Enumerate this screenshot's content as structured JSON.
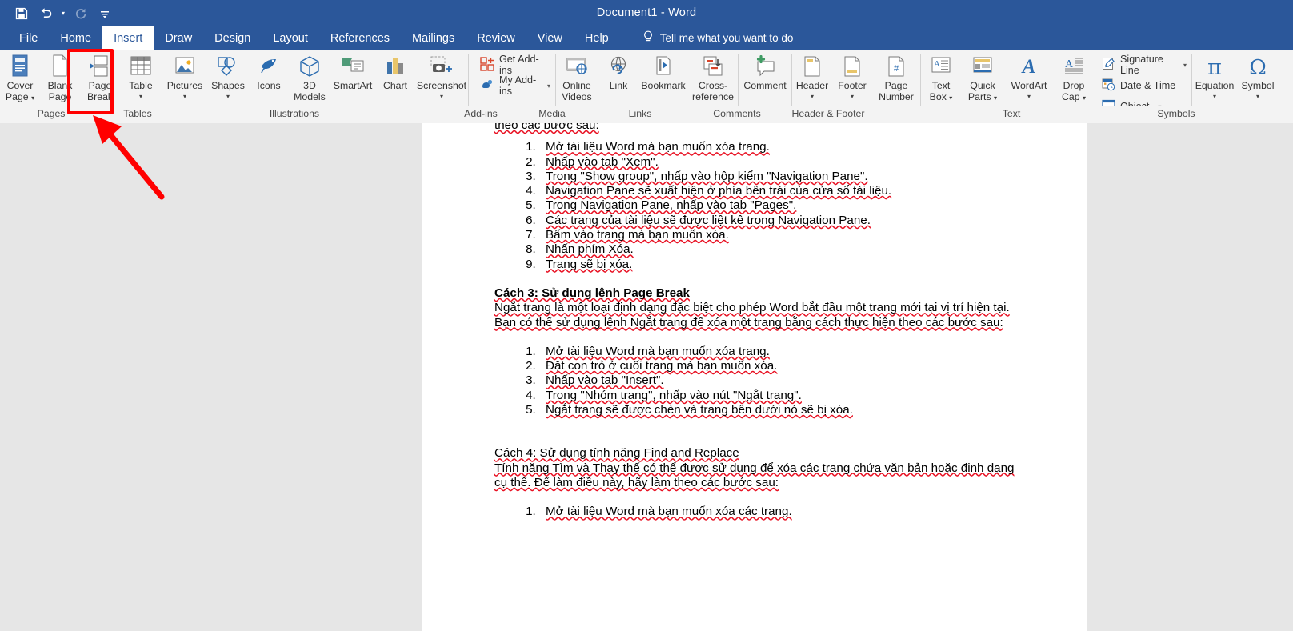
{
  "titlebar": {
    "document_title": "Document1  -  Word",
    "qat": [
      {
        "name": "save",
        "label": "Save"
      },
      {
        "name": "undo",
        "label": "Undo"
      },
      {
        "name": "redo",
        "label": "Redo"
      },
      {
        "name": "customize",
        "label": "Customize Quick Access Toolbar"
      }
    ]
  },
  "tabs": [
    {
      "label": "File",
      "active": false
    },
    {
      "label": "Home",
      "active": false
    },
    {
      "label": "Insert",
      "active": true
    },
    {
      "label": "Draw",
      "active": false
    },
    {
      "label": "Design",
      "active": false
    },
    {
      "label": "Layout",
      "active": false
    },
    {
      "label": "References",
      "active": false
    },
    {
      "label": "Mailings",
      "active": false
    },
    {
      "label": "Review",
      "active": false
    },
    {
      "label": "View",
      "active": false
    },
    {
      "label": "Help",
      "active": false
    }
  ],
  "tellme": {
    "label": "Tell me what you want to do",
    "icon": "lightbulb-icon"
  },
  "ribbon": {
    "groups": [
      {
        "label": "Pages",
        "buttons": [
          {
            "label": "Cover\nPage",
            "line1": "Cover",
            "line2": "Page",
            "caret": true
          },
          {
            "label": "Blank\nPage",
            "line1": "Blank",
            "line2": "Page",
            "caret": false
          },
          {
            "label": "Page\nBreak",
            "line1": "Page",
            "line2": "Break",
            "caret": false,
            "highlighted": true
          }
        ]
      },
      {
        "label": "Tables",
        "buttons": [
          {
            "line1": "Table",
            "line2": "",
            "caret": true
          }
        ]
      },
      {
        "label": "Illustrations",
        "buttons": [
          {
            "line1": "Pictures",
            "line2": "",
            "caret": true
          },
          {
            "line1": "Shapes",
            "line2": "",
            "caret": true
          },
          {
            "line1": "Icons",
            "line2": "",
            "caret": false
          },
          {
            "line1": "3D",
            "line2": "Models",
            "caret": true
          },
          {
            "line1": "SmartArt",
            "line2": "",
            "caret": false
          },
          {
            "line1": "Chart",
            "line2": "",
            "caret": false
          },
          {
            "line1": "Screenshot",
            "line2": "",
            "caret": true
          }
        ]
      },
      {
        "label": "Add-ins",
        "small_buttons": [
          {
            "label": "Get Add-ins",
            "caret": false
          },
          {
            "label": "My Add-ins",
            "caret": true
          }
        ]
      },
      {
        "label": "Media",
        "buttons": [
          {
            "line1": "Online",
            "line2": "Videos",
            "caret": false
          }
        ]
      },
      {
        "label": "Links",
        "buttons": [
          {
            "line1": "Link",
            "line2": "",
            "caret": false
          },
          {
            "line1": "Bookmark",
            "line2": "",
            "caret": false
          },
          {
            "line1": "Cross-",
            "line2": "reference",
            "caret": false
          }
        ]
      },
      {
        "label": "Comments",
        "buttons": [
          {
            "line1": "Comment",
            "line2": "",
            "caret": false
          }
        ]
      },
      {
        "label": "Header & Footer",
        "buttons": [
          {
            "line1": "Header",
            "line2": "",
            "caret": true
          },
          {
            "line1": "Footer",
            "line2": "",
            "caret": true
          },
          {
            "line1": "Page",
            "line2": "Number",
            "caret": true
          }
        ]
      },
      {
        "label": "Text",
        "buttons": [
          {
            "line1": "Text",
            "line2": "Box",
            "caret": true
          },
          {
            "line1": "Quick",
            "line2": "Parts",
            "caret": true
          },
          {
            "line1": "WordArt",
            "line2": "",
            "caret": true
          },
          {
            "line1": "Drop",
            "line2": "Cap",
            "caret": true
          }
        ],
        "small_buttons": [
          {
            "label": "Signature Line",
            "caret": true
          },
          {
            "label": "Date & Time",
            "caret": false
          },
          {
            "label": "Object",
            "caret": true
          }
        ]
      },
      {
        "label": "Symbols",
        "buttons": [
          {
            "line1": "Equation",
            "line2": "",
            "caret": true
          },
          {
            "line1": "Symbol",
            "line2": "",
            "caret": true
          }
        ]
      }
    ]
  },
  "document": {
    "partial_line": "theo các bước sau:",
    "list1": [
      "Mở tài liệu Word mà bạn muốn xóa trang.",
      "Nhấp vào tab \"Xem\".",
      "Trong \"Show group\", nhấp vào hộp kiểm \"Navigation Pane\".",
      "Navigation Pane sẽ xuất hiện ở phía bên trái của cửa sổ tài liệu.",
      "Trong Navigation Pane, nhấp vào tab \"Pages\".",
      "Các trang của tài liệu sẽ được liệt kê trong Navigation Pane.",
      "Bấm vào trang mà bạn muốn xóa.",
      "Nhấn phím Xóa.",
      "Trang sẽ bị xóa."
    ],
    "heading3": "Cách 3: Sử dụng lệnh Page Break",
    "para3": "Ngắt trang là một loại định dạng đặc biệt cho phép Word bắt đầu một trang mới tại vị trí hiện tại. Bạn có thể sử dụng lệnh Ngắt trang để xóa một trang bằng cách thực hiện theo các bước sau:",
    "list2": [
      "Mở tài liệu Word mà bạn muốn xóa trang.",
      "Đặt con trỏ ở cuối trang mà bạn muốn xóa.",
      "Nhấp vào tab \"Insert\".",
      "Trong \"Nhóm trang\", nhấp vào nút \"Ngắt trang\".",
      "Ngắt trang sẽ được chèn và trang bên dưới nó sẽ bị xóa."
    ],
    "heading4": "Cách 4: Sử dụng tính năng Find and Replace",
    "para4": "Tính năng Tìm và Thay thế có thể được sử dụng để xóa các trang chứa văn bản hoặc định dạng cụ thể. Để làm điều này, hãy làm theo các bước sau:",
    "list3": [
      "Mở tài liệu Word mà bạn muốn xóa các trang."
    ]
  },
  "annotations": {
    "highlight_color": "#ff0000",
    "arrow_color": "#ff0000",
    "target": "Page Break button"
  },
  "colors": {
    "titlebar": "#2b579a",
    "ribbon_bg": "#f3f3f3",
    "canvas_bg": "#e6e6e6",
    "page_bg": "#ffffff",
    "accent_icon": "#2b6cb0",
    "spellcheck_squiggle": "#e81123"
  }
}
